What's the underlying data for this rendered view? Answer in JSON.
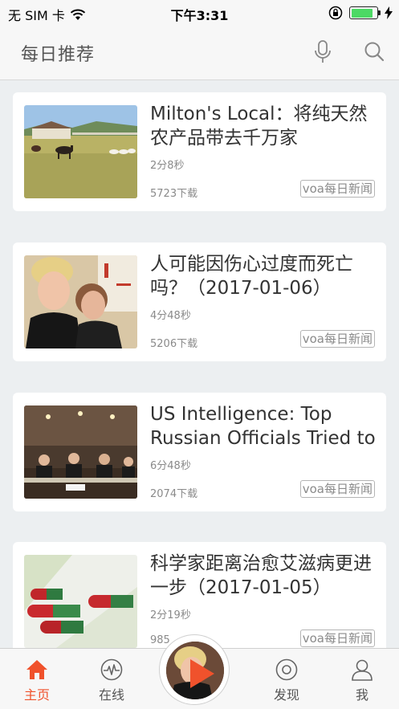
{
  "status_bar": {
    "carrier": "无 SIM 卡",
    "time": "下午3:31",
    "battery_level": 0.85,
    "colors": {
      "battery": "#4cd964"
    }
  },
  "header": {
    "title": "每日推荐",
    "icons": [
      "microphone-icon",
      "search-icon"
    ]
  },
  "articles": [
    {
      "title": "Milton's Local：将纯天然农产品带去千万家",
      "duration": "2分8秒",
      "downloads": "5723下载",
      "tag": "voa每日新闻"
    },
    {
      "title": "人可能因伤心过度而死亡吗？（2017-01-06）",
      "duration": "4分48秒",
      "downloads": "5206下载",
      "tag": "voa每日新闻"
    },
    {
      "title": "US Intelligence: Top Russian Officials Tried to",
      "duration": "6分48秒",
      "downloads": "2074下载",
      "tag": "voa每日新闻"
    },
    {
      "title": "科学家距离治愈艾滋病更进一步（2017-01-05）",
      "duration": "2分19秒",
      "downloads": "985",
      "tag": "voa每日新闻"
    }
  ],
  "tab_bar": {
    "tabs": [
      {
        "label": "主页",
        "icon": "home-icon",
        "active": true
      },
      {
        "label": "在线",
        "icon": "live-pulse-icon",
        "active": false
      },
      {
        "label": "发现",
        "icon": "discover-icon",
        "active": false
      },
      {
        "label": "我",
        "icon": "profile-icon",
        "active": false
      }
    ],
    "player_icon": "play-icon",
    "colors": {
      "active": "#f0522c",
      "inactive": "#555555"
    }
  }
}
